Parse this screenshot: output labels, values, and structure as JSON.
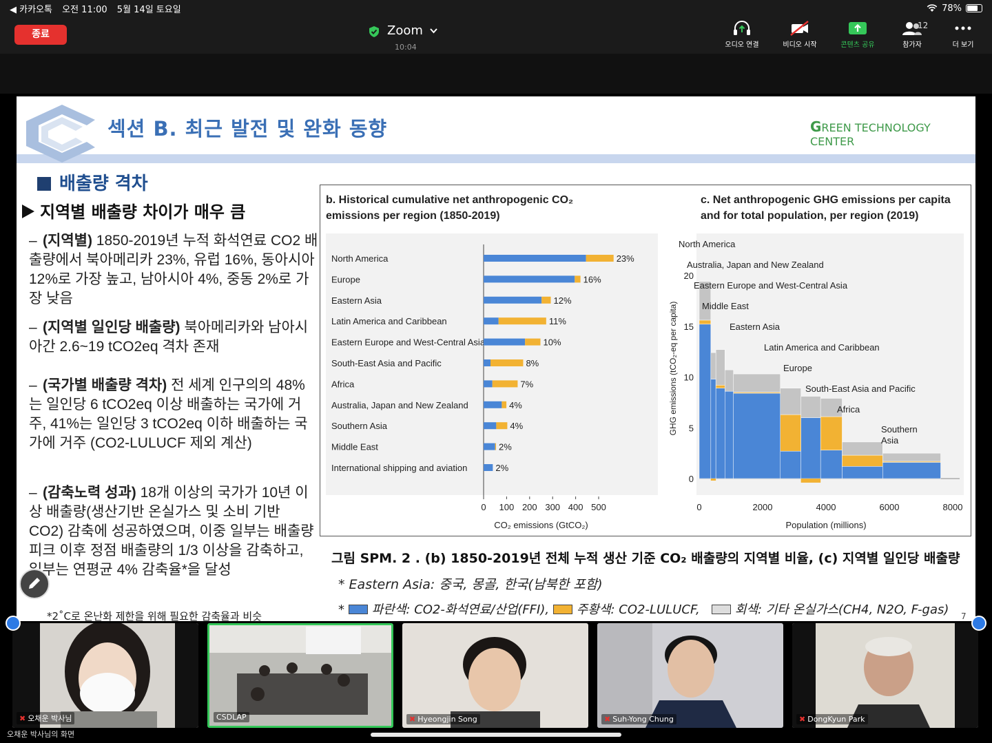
{
  "status_bar": {
    "back_app": "◀ 카카오톡",
    "time": "오전 11:00",
    "date": "5월 14일 토요일",
    "battery": "78%",
    "battery_level": 0.78
  },
  "toolbar": {
    "end_label": "종료",
    "title": "Zoom",
    "elapsed": "10:04",
    "audio_label": "오디오 연결",
    "video_label": "비디오 시작",
    "share_label": "콘텐츠 공유",
    "participants_label": "참가자",
    "participants_count": "12",
    "more_label": "더 보기",
    "accent_green": "#35c759",
    "end_red": "#e5312e"
  },
  "slide": {
    "section_title": "섹션 B. 최근 발전 및 완화 동향",
    "org": "REEN TECHNOLOGY CENTER",
    "org_initial": "G",
    "subheading": "배출량 격차",
    "main_bullet": "지역별 배출량 차이가 매우 큼",
    "bullets": [
      {
        "label": "(지역별)",
        "text": "1850-2019년 누적 화석연료 CO2 배출량에서 북아메리카 23%, 유럽 16%, 동아시아 12%로 가장 높고, 남아시아 4%, 중동 2%로 가장 낮음"
      },
      {
        "label": "(지역별 일인당 배출량)",
        "text": "북아메리카와 남아시아간 2.6~19 tCO2eq 격차 존재"
      },
      {
        "label": "(국가별 배출량 격차)",
        "text": "전 세계 인구의의 48%는 일인당 6 tCO2eq 이상 배출하는 국가에 거주, 41%는 일인당 3 tCO2eq 이하 배출하는 국가에 거주 (CO2-LULUCF 제외 계산)"
      },
      {
        "label": "(감축노력 성과)",
        "text": "18개 이상의 국가가 10년 이상 배출량(생산기반 온실가스 및 소비 기반 CO2) 감축에 성공하였으며, 이중 일부는 배출량피크 이후 정점 배출량의 1/3 이상을 감축하고, 일부는 연평균 4% 감축율*을 달성"
      }
    ],
    "footnote": "*2˚C로 온난화 제한을 위해 필요한 감축율과 비슷",
    "fig_b_title": "b. Historical cumulative net anthropogenic CO₂ emissions per region (1850-2019)",
    "fig_c_title": "c. Net anthropogenic GHG emissions per capita and for total population, per region (2019)",
    "caption": "그림 SPM. 2 . (b) 1850-2019년 전체 누적 생산 기준 CO₂ 배출량의 지역별 비율, (c) 지역별 일인당 배출량",
    "note_east_asia": "* Eastern Asia: 중국, 몽골, 한국(남북한 포함)",
    "legend_blue": "파란색: CO2-화석연료/산업(FFI),",
    "legend_yellow": "주황색: CO2-LULUCF,",
    "legend_gray": "회색: 기타 온실가스(CH4, N2O, F-gas)",
    "page_number": "7",
    "colors": {
      "ffi": "#4a86d6",
      "lulucf": "#f2b233",
      "other": "#c4c4c4",
      "title_blue": "#3a6fb5"
    }
  },
  "chart_data": [
    {
      "type": "bar",
      "orientation": "horizontal",
      "stacked": true,
      "title": "b. Historical cumulative net anthropogenic CO₂ emissions per region (1850-2019)",
      "xlabel": "CO₂ emissions (GtCO₂)",
      "xlim": [
        0,
        500
      ],
      "xticks": [
        0,
        100,
        200,
        300,
        400,
        500
      ],
      "categories": [
        "North America",
        "Europe",
        "Eastern Asia",
        "Latin America and Caribbean",
        "Eastern Europe and West-Central Asia",
        "South-East Asia and Pacific",
        "Africa",
        "Australia, Japan and New Zealand",
        "Southern Asia",
        "Middle East",
        "International shipping and aviation"
      ],
      "series": [
        {
          "name": "CO2-FFI",
          "color": "#4a86d6",
          "values": [
            445,
            396,
            252,
            65,
            180,
            30,
            38,
            79,
            55,
            50,
            40
          ]
        },
        {
          "name": "CO2-LULUCF",
          "color": "#f2b233",
          "values": [
            120,
            25,
            40,
            207,
            67,
            142,
            110,
            20,
            48,
            4,
            0
          ]
        }
      ],
      "labels": [
        "23%",
        "16%",
        "12%",
        "11%",
        "10%",
        "8%",
        "7%",
        "4%",
        "4%",
        "2%",
        "2%"
      ]
    },
    {
      "type": "bar",
      "variable_width": true,
      "stacked": true,
      "title": "c. Net anthropogenic GHG emissions per capita and for total population, per region (2019)",
      "xlabel": "Population (millions)",
      "ylabel": "GHG emissions (tCO₂-eq per capita)",
      "xlim": [
        0,
        8000
      ],
      "ylim": [
        -0.5,
        21
      ],
      "xticks": [
        0,
        2000,
        4000,
        6000,
        8000
      ],
      "yticks": [
        0,
        5,
        10,
        15,
        20
      ],
      "regions": [
        {
          "name": "North America",
          "x0": 0,
          "x1": 366,
          "ffi": 15.2,
          "lulucf": 0.4,
          "other": 3.8
        },
        {
          "name": "Australia, Japan and New Zealand",
          "x0": 366,
          "x1": 525,
          "ffi": 9.8,
          "lulucf": -0.2,
          "other": 2.6
        },
        {
          "name": "Eastern Europe and West-Central Asia",
          "x0": 525,
          "x1": 810,
          "ffi": 8.9,
          "lulucf": 0.3,
          "other": 3.5
        },
        {
          "name": "Middle East",
          "x0": 810,
          "x1": 1080,
          "ffi": 8.6,
          "lulucf": 0.0,
          "other": 2.1
        },
        {
          "name": "Eastern Asia",
          "x0": 1080,
          "x1": 2560,
          "ffi": 8.4,
          "lulucf": 0.1,
          "other": 1.8
        },
        {
          "name": "Latin America and Caribbean",
          "x0": 2560,
          "x1": 3210,
          "ffi": 2.7,
          "lulucf": 3.6,
          "other": 2.6
        },
        {
          "name": "Europe",
          "x0": 3210,
          "x1": 3830,
          "ffi": 6.0,
          "lulucf": -0.4,
          "other": 2.1
        },
        {
          "name": "South-East Asia and Pacific",
          "x0": 3830,
          "x1": 4510,
          "ffi": 2.8,
          "lulucf": 3.3,
          "other": 1.8
        },
        {
          "name": "Africa",
          "x0": 4510,
          "x1": 5790,
          "ffi": 1.2,
          "lulucf": 1.1,
          "other": 1.3
        },
        {
          "name": "Southern Asia",
          "x0": 5790,
          "x1": 7620,
          "ffi": 1.6,
          "lulucf": 0.1,
          "other": 0.8
        }
      ]
    }
  ],
  "participants": [
    {
      "name": "오채운 박사님",
      "muted": true
    },
    {
      "name": "CSDLAP",
      "muted": false,
      "active": true
    },
    {
      "name": "Hyeongjin Song",
      "muted": true
    },
    {
      "name": "Suh-Yong Chung",
      "muted": true
    },
    {
      "name": "DongKyun Park",
      "muted": true
    }
  ],
  "screen_label": "오채운 박사님의 화면"
}
